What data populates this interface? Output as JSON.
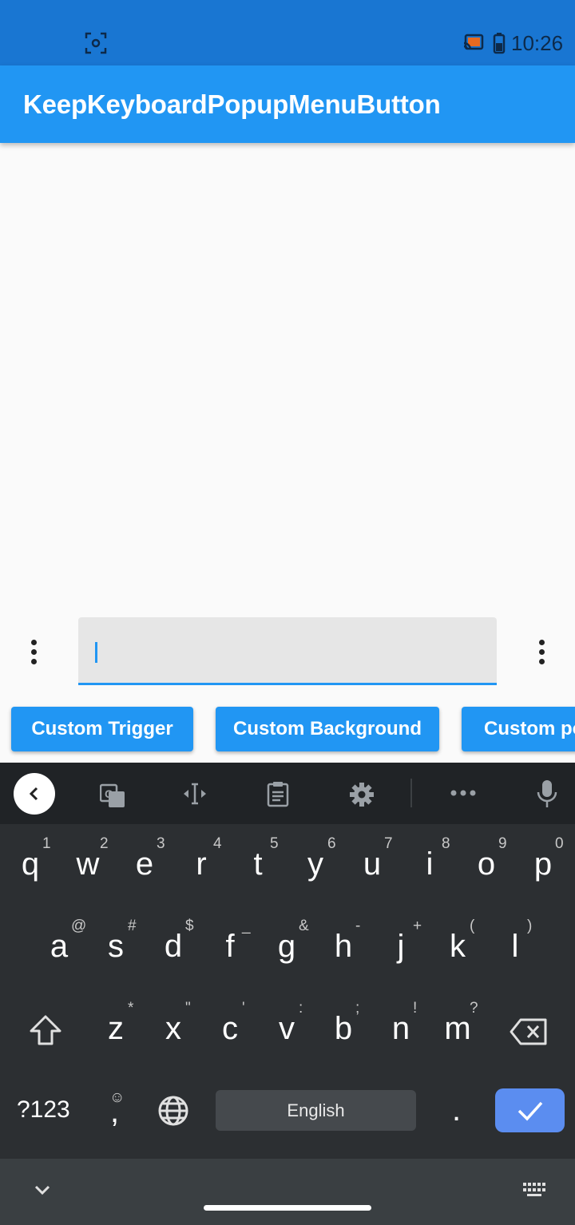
{
  "status": {
    "time": "10:26"
  },
  "app_bar": {
    "title": "KeepKeyboardPopupMenuButton"
  },
  "text_field": {
    "value": ""
  },
  "buttons": [
    {
      "label": "Custom Trigger"
    },
    {
      "label": "Custom Background"
    },
    {
      "label": "Custom po"
    }
  ],
  "keyboard": {
    "row1": [
      {
        "k": "q",
        "h": "1"
      },
      {
        "k": "w",
        "h": "2"
      },
      {
        "k": "e",
        "h": "3"
      },
      {
        "k": "r",
        "h": "4"
      },
      {
        "k": "t",
        "h": "5"
      },
      {
        "k": "y",
        "h": "6"
      },
      {
        "k": "u",
        "h": "7"
      },
      {
        "k": "i",
        "h": "8"
      },
      {
        "k": "o",
        "h": "9"
      },
      {
        "k": "p",
        "h": "0"
      }
    ],
    "row2": [
      {
        "k": "a",
        "h": "@"
      },
      {
        "k": "s",
        "h": "#"
      },
      {
        "k": "d",
        "h": "$"
      },
      {
        "k": "f",
        "h": "_"
      },
      {
        "k": "g",
        "h": "&"
      },
      {
        "k": "h",
        "h": "-"
      },
      {
        "k": "j",
        "h": "+"
      },
      {
        "k": "k",
        "h": "("
      },
      {
        "k": "l",
        "h": ")"
      }
    ],
    "row3": [
      {
        "k": "z",
        "h": "*"
      },
      {
        "k": "x",
        "h": "\""
      },
      {
        "k": "c",
        "h": "'"
      },
      {
        "k": "v",
        "h": ":"
      },
      {
        "k": "b",
        "h": ";"
      },
      {
        "k": "n",
        "h": "!"
      },
      {
        "k": "m",
        "h": "?"
      }
    ],
    "symbols_label": "?123",
    "comma": ",",
    "space_label": "English",
    "period": "."
  },
  "colors": {
    "status_bar": "#1976d2",
    "app_bar": "#2196f3",
    "keyboard_bg": "#2c2f32",
    "accent": "#2196f3"
  }
}
